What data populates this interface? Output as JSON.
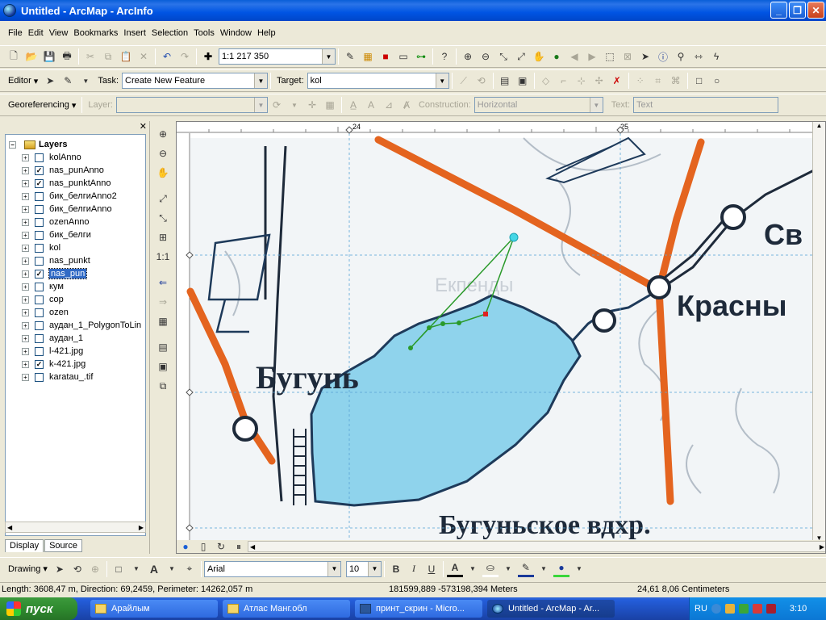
{
  "window": {
    "title": "Untitled - ArcMap - ArcInfo"
  },
  "menu": [
    "File",
    "Edit",
    "View",
    "Bookmarks",
    "Insert",
    "Selection",
    "Tools",
    "Window",
    "Help"
  ],
  "standard_toolbar": {
    "scale": "1:1 217 350"
  },
  "editor_toolbar": {
    "editor_label": "Editor",
    "task_label": "Task:",
    "task_value": "Create New Feature",
    "target_label": "Target:",
    "target_value": "kol"
  },
  "georef_toolbar": {
    "georef_label": "Georeferencing",
    "layer_label": "Layer:",
    "construction_label": "Construction:",
    "construction_value": "Horizontal",
    "text_label": "Text:",
    "text_value": "Text"
  },
  "toc": {
    "root": "Layers",
    "layers": [
      {
        "name": "kolAnno",
        "checked": false
      },
      {
        "name": "nas_punAnno",
        "checked": true
      },
      {
        "name": "nas_punktAnno",
        "checked": true
      },
      {
        "name": "бик_белгиAnno2",
        "checked": false
      },
      {
        "name": "бик_белгиAnno",
        "checked": false
      },
      {
        "name": "ozenAnno",
        "checked": false
      },
      {
        "name": "бик_белги",
        "checked": false
      },
      {
        "name": "kol",
        "checked": false
      },
      {
        "name": "nas_punkt",
        "checked": false
      },
      {
        "name": "nas_pun",
        "checked": true,
        "selected": true
      },
      {
        "name": "кум",
        "checked": false
      },
      {
        "name": "cop",
        "checked": false
      },
      {
        "name": "ozen",
        "checked": false
      },
      {
        "name": "аудан_1_PolygonToLin",
        "checked": false
      },
      {
        "name": "аудан_1",
        "checked": false
      },
      {
        "name": "l-421.jpg",
        "checked": false
      },
      {
        "name": "k-421.jpg",
        "checked": true
      },
      {
        "name": "karatau_.tif",
        "checked": false
      }
    ],
    "tabs": [
      "Display",
      "Source"
    ]
  },
  "map": {
    "ruler_x": [
      "24",
      "25"
    ],
    "labels": {
      "town_left": "Бугунь",
      "town_right": "Красны",
      "town_top": "Св",
      "reservoir": "Бугуньское вдхр.",
      "faded": "Екпенды"
    },
    "colors": {
      "water": "#8fd3ec",
      "road": "#e4641f",
      "shoreline": "#1e3a5a",
      "sketch": "#2a9a2a",
      "vertex_active": "#e02020"
    }
  },
  "drawing_toolbar": {
    "drawing_label": "Drawing",
    "font": "Arial",
    "size": "10",
    "bold": "B",
    "italic": "I",
    "underline": "U",
    "font_color_glyph": "A"
  },
  "status": {
    "measure": "Length: 3608,47 m, Direction: 69,2459, Perimeter: 14262,057 m",
    "coords": "181599,889  -573198,394 Meters",
    "page_coords": "24,61  8,06 Centimeters"
  },
  "taskbar": {
    "start": "пуск",
    "tasks": [
      "Арайлым",
      "Атлас Манг.обл",
      "принт_скрин - Micro...",
      "Untitled - ArcMap - Ar..."
    ],
    "lang": "RU",
    "clock": "3:10"
  }
}
